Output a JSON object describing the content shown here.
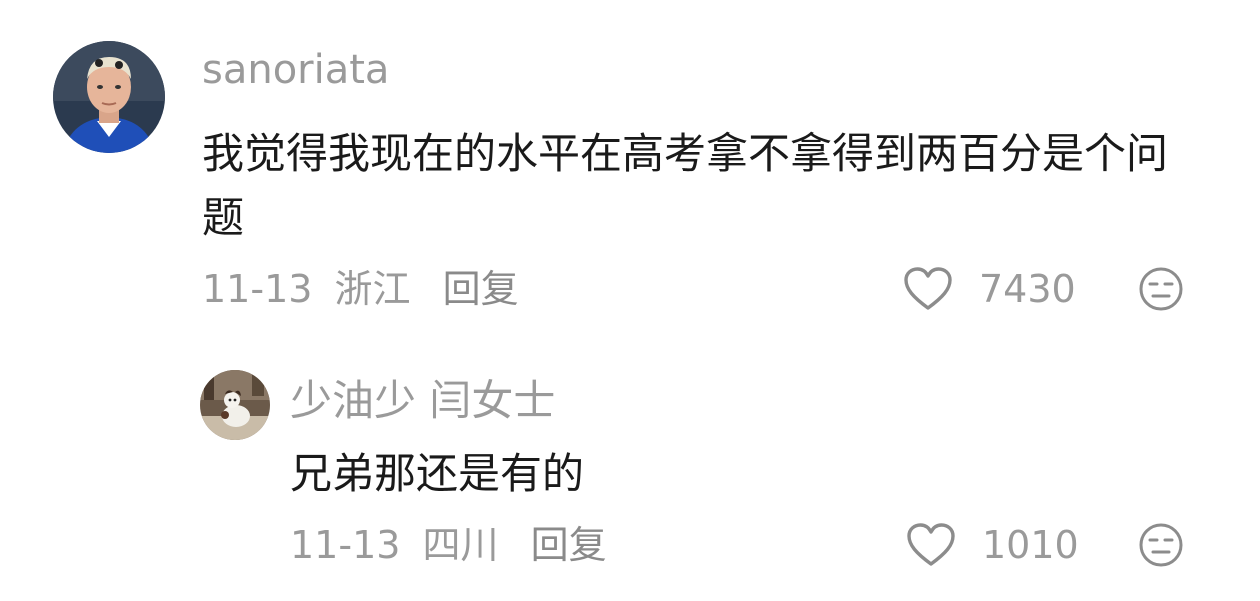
{
  "comments": [
    {
      "username": "sanoriata",
      "content": "我觉得我现在的水平在高考拿不拿得到两百分是个问题",
      "date": "11-13",
      "location": "浙江",
      "reply_label": "回复",
      "likes": "7430",
      "avatar_icon": "footballer-avatar",
      "like_icon": "heart-outline-icon",
      "dislike_icon": "meh-face-icon"
    }
  ],
  "replies": [
    {
      "username": "少油少 闫女士",
      "content": "兄弟那还是有的",
      "date": "11-13",
      "location": "四川",
      "reply_label": "回复",
      "likes": "1010",
      "avatar_icon": "dog-photo-avatar",
      "like_icon": "heart-outline-icon",
      "dislike_icon": "meh-face-icon"
    }
  ],
  "colors": {
    "muted_text": "#9a9a9a",
    "body_text": "#1a1a1a",
    "icon_stroke": "#8c8c8c",
    "background": "#ffffff"
  }
}
